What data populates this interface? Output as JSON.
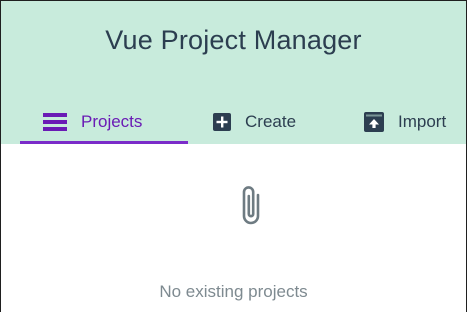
{
  "app": {
    "title": "Vue Project Manager"
  },
  "tabs": [
    {
      "label": "Projects",
      "icon": "list-icon",
      "active": true
    },
    {
      "label": "Create",
      "icon": "plus-box-icon",
      "active": false
    },
    {
      "label": "Import",
      "icon": "archive-upload-icon",
      "active": false
    }
  ],
  "empty_state": {
    "icon": "paperclip-icon",
    "message": "No existing projects"
  },
  "colors": {
    "header_bg": "#c8ebdc",
    "accent": "#7b2cc9",
    "text": "#2c3e50",
    "muted": "#7e8a90"
  }
}
